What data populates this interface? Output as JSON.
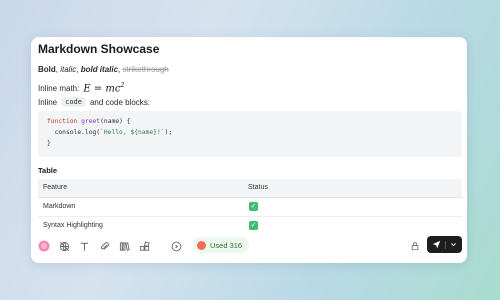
{
  "doc": {
    "title": "Markdown Showcase",
    "formatting": {
      "bold": "Bold",
      "sep1": ", ",
      "italic": "italic",
      "sep2": ", ",
      "bold_italic": "bold italic",
      "sep3": ", ",
      "strike": "strikethrough"
    },
    "inline_math_label": "Inline math:",
    "inline_math_formula": "E = mc",
    "inline_math_power": "2",
    "inline_label": "Inline",
    "inline_code": "code",
    "inline_suffix": "and code blocks:",
    "code": {
      "line1_kw": "function",
      "line1_fn": "greet",
      "line1_rest": "(name) {",
      "line2_a": "  console.log(",
      "line2_str": "`Hello, ${name}!`",
      "line2_b": ");",
      "line3": "}"
    },
    "table": {
      "title": "Table",
      "headers": [
        "Feature",
        "Status"
      ],
      "rows": [
        {
          "feature": "Markdown",
          "status": "✓"
        },
        {
          "feature": "Syntax Highlighting",
          "status": "✓"
        }
      ]
    }
  },
  "toolbar": {
    "used_label": "Used 316",
    "icons": [
      "avatar-icon",
      "globe-off-icon",
      "text-icon",
      "paperclip-icon",
      "books-icon",
      "blocks-icon",
      "help-icon",
      "lock-icon",
      "send-icon",
      "chevron-down-icon"
    ],
    "colors": {
      "avatar": "#f08bb4",
      "send_bg": "#1e1e1e",
      "check": "#3fbf6b"
    }
  }
}
